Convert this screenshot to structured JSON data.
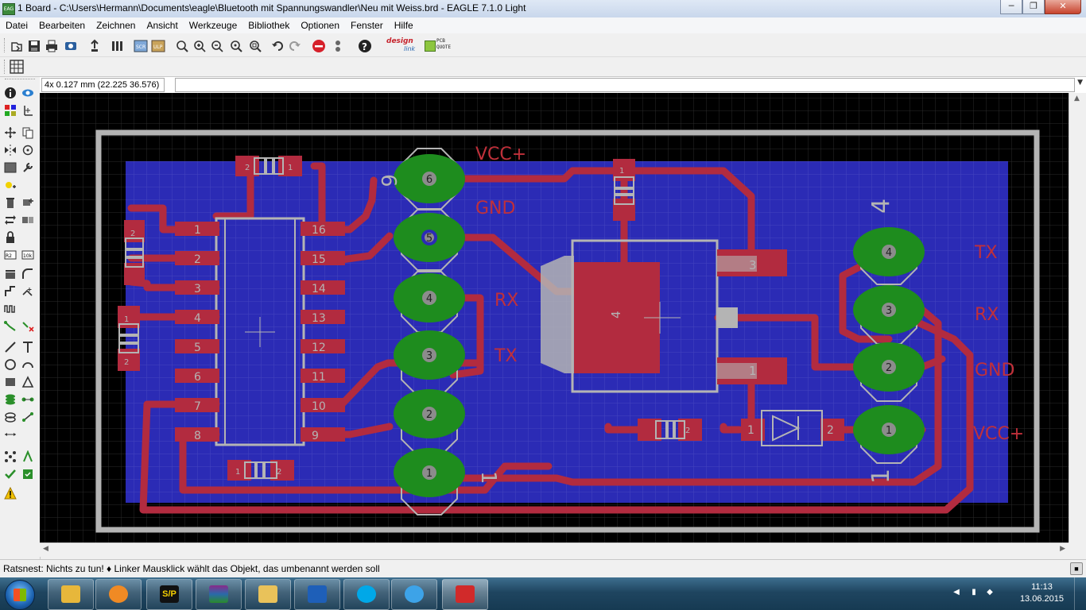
{
  "window": {
    "title": "1 Board - C:\\Users\\Hermann\\Documents\\eagle\\Bluetooth mit Spannungswandler\\Neu mit Weiss.brd - EAGLE 7.1.0 Light",
    "app_icon_text": "EAG",
    "minimize": "─",
    "maximize": "❐",
    "close": "✕"
  },
  "menu": [
    "Datei",
    "Bearbeiten",
    "Zeichnen",
    "Ansicht",
    "Werkzeuge",
    "Bibliothek",
    "Optionen",
    "Fenster",
    "Hilfe"
  ],
  "toolbar": {
    "designlink_label": "design",
    "designlink_sub": "link",
    "pcbquote_label": "PCB",
    "pcbquote_sub": "QUOTE"
  },
  "coordinates": "4x 0.127 mm (22.225 36.576)",
  "board": {
    "header_left_labels": [
      "VCC+",
      "GND",
      "RX",
      "TX"
    ],
    "header_right_labels": [
      "TX",
      "RX",
      "GND",
      "VCC+"
    ],
    "left_header_pins": [
      "6",
      "5",
      "4",
      "3",
      "2",
      "1"
    ],
    "right_header_pins": [
      "4",
      "3",
      "2",
      "1"
    ],
    "ic_left_pins": [
      "1",
      "2",
      "3",
      "4",
      "5",
      "6",
      "7",
      "8"
    ],
    "ic_right_pins": [
      "16",
      "15",
      "14",
      "13",
      "12",
      "11",
      "10",
      "9"
    ],
    "regulator_pins": [
      "3",
      "4",
      "1"
    ],
    "diode_pins": [
      "1",
      "2"
    ],
    "left_header_mark_top": "6",
    "left_header_mark_bottom": "1",
    "right_header_mark_top": "4",
    "right_header_mark_bottom": "1",
    "cap_labels": [
      "2",
      "1",
      "2",
      "1",
      "2",
      "1",
      "2",
      "1",
      "2"
    ],
    "colors": {
      "background": "#000000",
      "copper_pour": "#2b2bb5",
      "trace": "#b22b3f",
      "pad": "#1e8c1e",
      "silk": "#b4b4b4",
      "label": "#c0303a"
    }
  },
  "status": {
    "message": "Ratsnest: Nichts zu tun! ♦ Linker Mausklick wählt das Objekt, das umbenannt werden soll"
  },
  "taskbar": {
    "apps": [
      "outlook",
      "media-player",
      "sp-app",
      "winrar",
      "explorer",
      "email",
      "skype",
      "internet-explorer",
      "eagle"
    ],
    "sp_label": "S/P",
    "time": "11:13",
    "date": "13.06.2015",
    "tray_arrow": "◀"
  }
}
